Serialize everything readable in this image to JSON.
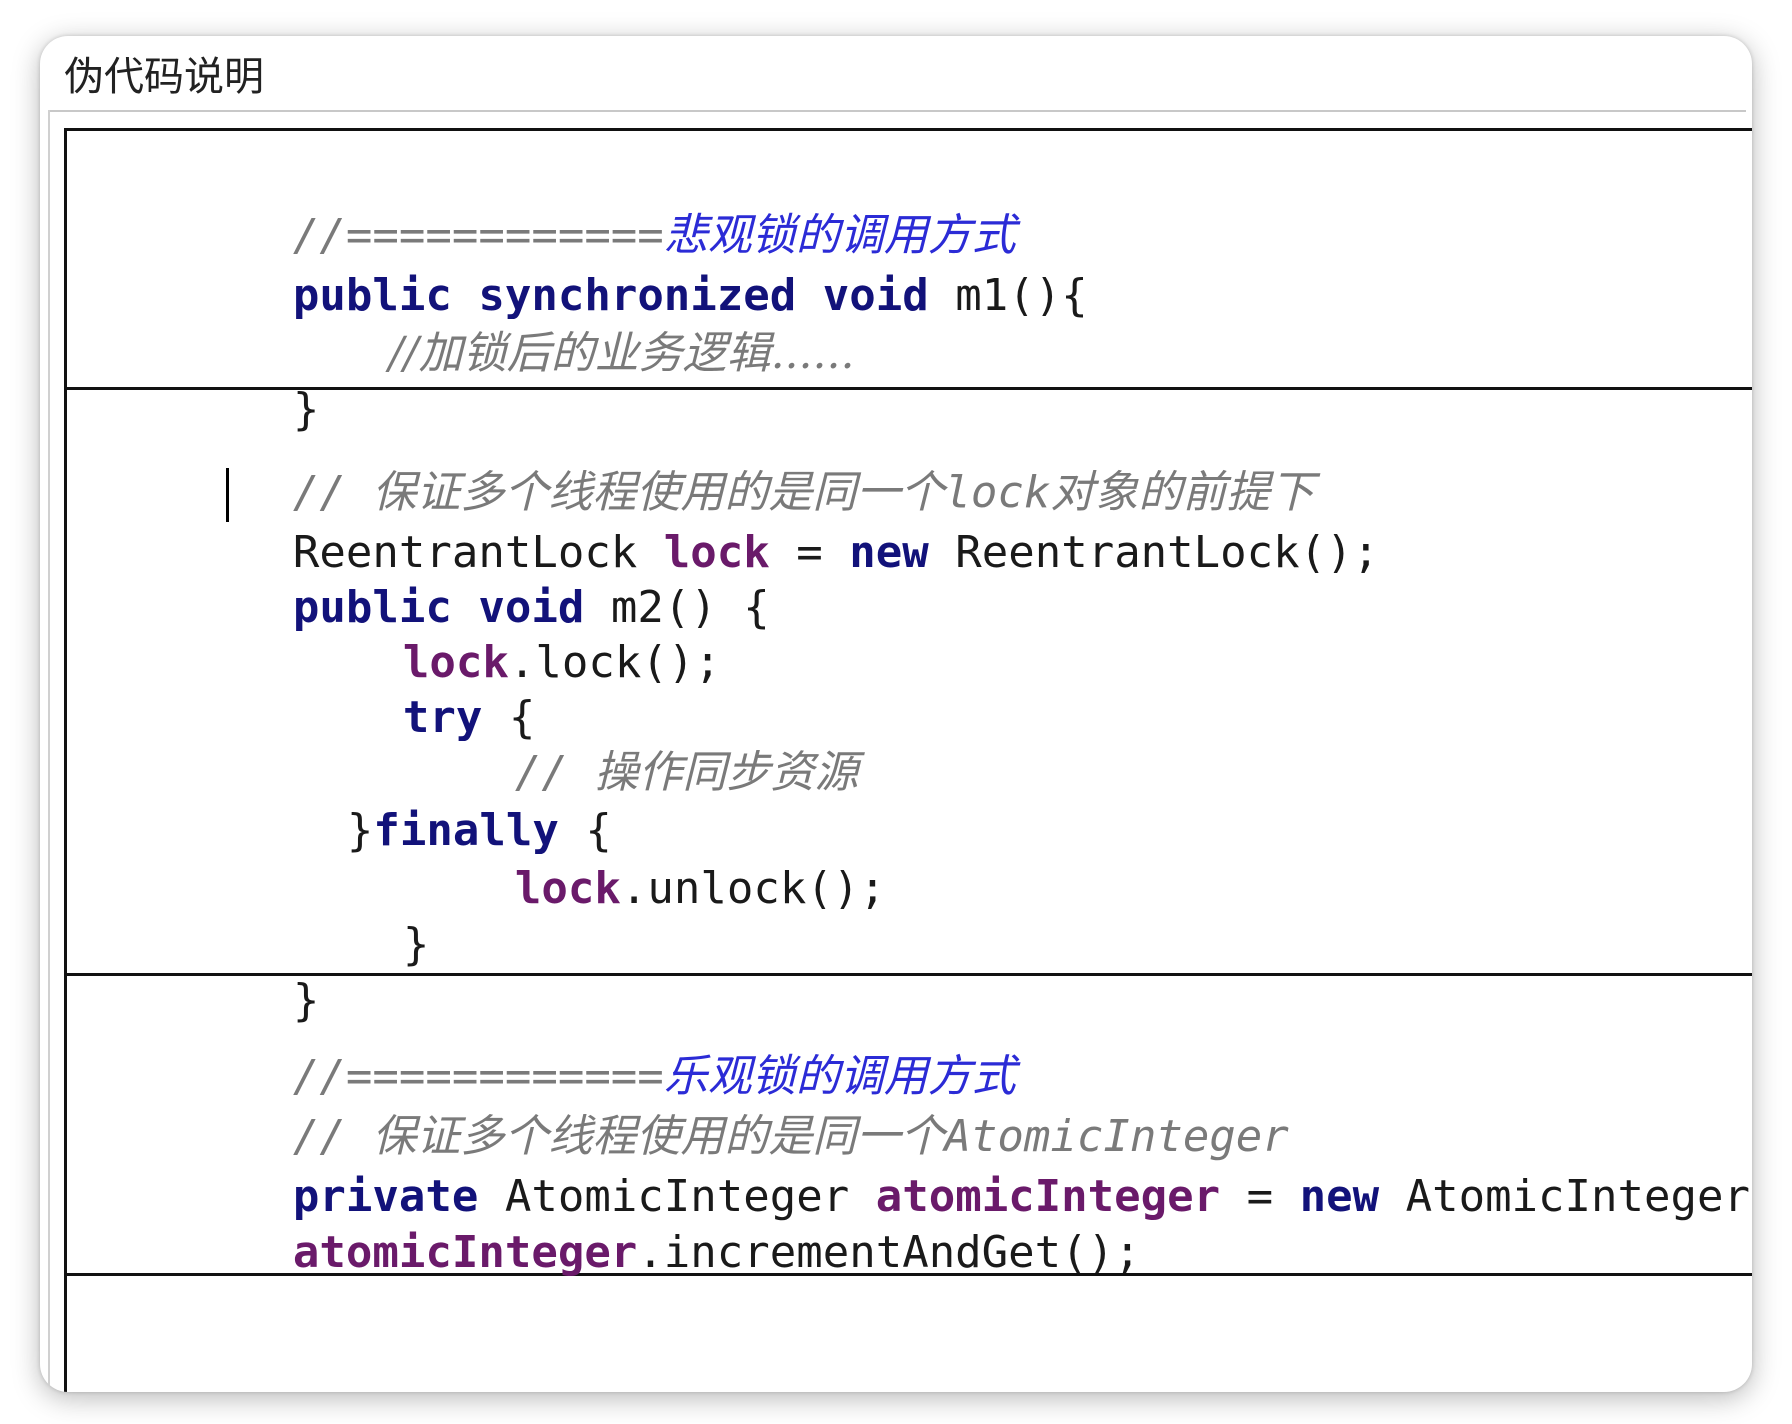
{
  "window": {
    "title": "伪代码说明"
  },
  "blocks": {
    "pessimistic": {
      "l1_prefix": "//============",
      "l1_title": "悲观锁的调用方式",
      "l2_kw1": "public",
      "l2_kw2": "synchronized",
      "l2_kw3": "void",
      "l2_rest": "m1(){",
      "l3_comment": "//加锁后的业务逻辑......",
      "l4": "}"
    },
    "reentrant": {
      "c1_slashes": "//",
      "c1_text": "保证多个线程使用的是同一个",
      "c1_lock": "lock",
      "c1_text2": "对象的前提下",
      "l2_type": "ReentrantLock",
      "l2_field": "lock",
      "l2_eq": "=",
      "l2_new": "new",
      "l2_rest": "ReentrantLock();",
      "l3_kw1": "public",
      "l3_kw2": "void",
      "l3_rest": "m2() {",
      "l4_field": "lock",
      "l4_rest": ".lock();",
      "l5_kw": "try",
      "l5_rest": "{",
      "l6_slashes": "//",
      "l6_text": "操作同步资源",
      "l7_brace": "}",
      "l7_kw": "finally",
      "l7_rest": "{",
      "l8_field": "lock",
      "l8_rest": ".unlock();",
      "l9": "}",
      "l10": "}"
    },
    "optimistic": {
      "l1_prefix": "//============",
      "l1_title": "乐观锁的调用方式",
      "c2_slashes": "//",
      "c2_text": "保证多个线程使用的是同一个",
      "c2_type": "AtomicInteger",
      "l3_kw": "private",
      "l3_type": "AtomicInteger",
      "l3_field": "atomicInteger",
      "l3_eq": "=",
      "l3_new": "new",
      "l3_rest": "AtomicInteger();",
      "l4_field": "atomicInteger",
      "l4_rest": ".incrementAndGet();"
    }
  }
}
